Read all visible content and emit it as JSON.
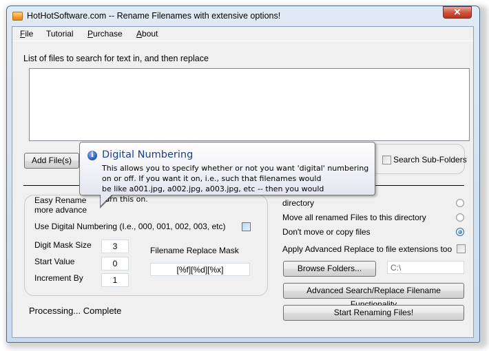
{
  "window": {
    "title": "HotHotSoftware.com -- Rename Filenames with extensive options!",
    "close_label": "✕"
  },
  "menu": {
    "items": [
      {
        "label": "File",
        "accel": "F",
        "rest": "ile"
      },
      {
        "label": "Tutorial",
        "accel": "",
        "rest": "Tutorial"
      },
      {
        "label": "Purchase",
        "accel": "P",
        "rest": "urchase"
      },
      {
        "label": "About",
        "accel": "A",
        "rest": "bout"
      }
    ]
  },
  "files": {
    "list_label": "List of files to search for text in, and then replace",
    "add_button": "Add File(s)",
    "search_subfolders_label": "Search Sub-Folders",
    "search_subfolders_checked": false
  },
  "easy_rename": {
    "intro_line1": "Easy Rename",
    "intro_line2": "more advance",
    "digital_numbering_label": "Use Digital Numbering (I.e., 000, 001, 002, 003, etc)",
    "digital_numbering_checked": false,
    "digit_mask_label": "Digit Mask Size",
    "digit_mask_value": "3",
    "start_value_label": "Start Value",
    "start_value": "0",
    "increment_label": "Increment By",
    "increment_value": "1",
    "replace_mask_label": "Filename Replace Mask",
    "replace_mask_value": "[%f][%d][%x]"
  },
  "options": {
    "radio1_label": "directory",
    "radio1_checked": false,
    "radio2_label": "Move all renamed Files to this directory",
    "radio2_checked": false,
    "radio3_label": "Don't move or copy files",
    "radio3_checked": true,
    "apply_ext_label": "Apply Advanced Replace to file extensions too",
    "apply_ext_checked": false,
    "browse_button": "Browse Folders...",
    "folder_path": "C:\\",
    "advanced_button": "Advanced Search/Replace Filename Functionality",
    "start_button": "Start Renaming Files!"
  },
  "status": {
    "text": "Processing... Complete"
  },
  "tooltip": {
    "icon": "info-icon",
    "title": "Digital Numbering",
    "body": "This allows you to specify whether or not you want 'digital' numbering\non or off. If you want it on, i.e., such that filenames would\nbe like a001.jpg, a002.jpg, a003.jpg, etc -- then you would\nturn this on."
  }
}
